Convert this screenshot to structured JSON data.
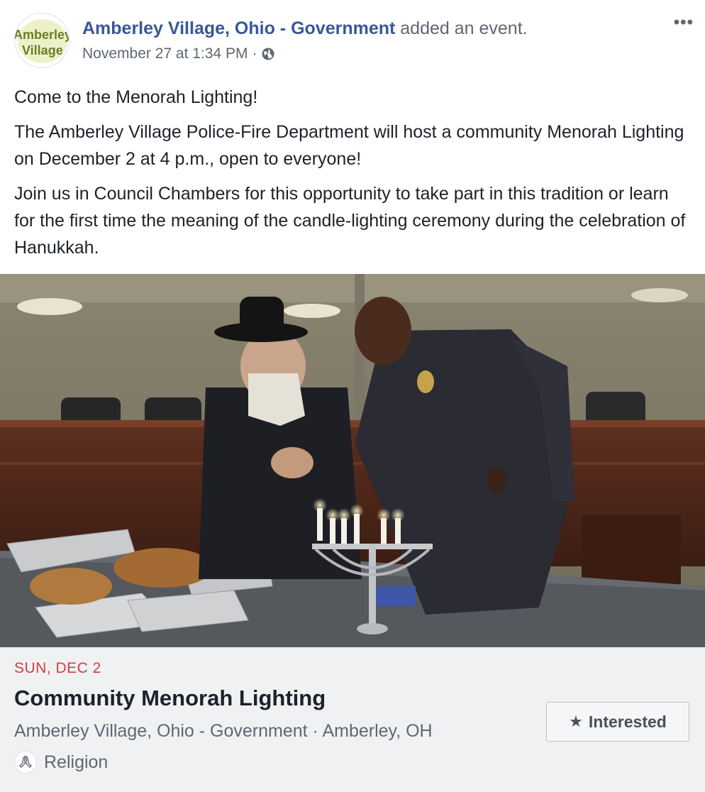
{
  "post": {
    "avatar_text_line1": "Amberley",
    "avatar_text_line2": "Village",
    "author": "Amberley Village, Ohio - Government",
    "action": " added an event.",
    "timestamp": "November 27 at 1:34 PM",
    "separator": "·",
    "privacy_icon": "globe-icon",
    "more_icon": "•••",
    "paragraphs": [
      "Come to the Menorah Lighting!",
      "The Amberley Village Police-Fire Department will host a community Menorah Lighting on December 2 at 4 p.m., open to everyone!",
      "Join us in Council Chambers for this opportunity to take part in this tradition or learn for the first time the meaning of the candle-lighting ceremony during the celebration of Hanukkah."
    ]
  },
  "event": {
    "date": "SUN, DEC 2",
    "title": "Community Menorah Lighting",
    "host_location": "Amberley Village, Ohio - Government · Amberley, OH",
    "category": "Religion",
    "category_icon": "praying-hands-icon",
    "interested_label": "Interested",
    "interested_icon": "star-icon"
  },
  "colors": {
    "author_link": "#385898",
    "secondary_text": "#606770",
    "event_date": "#d13f3f",
    "card_background": "#f0f1f3"
  }
}
